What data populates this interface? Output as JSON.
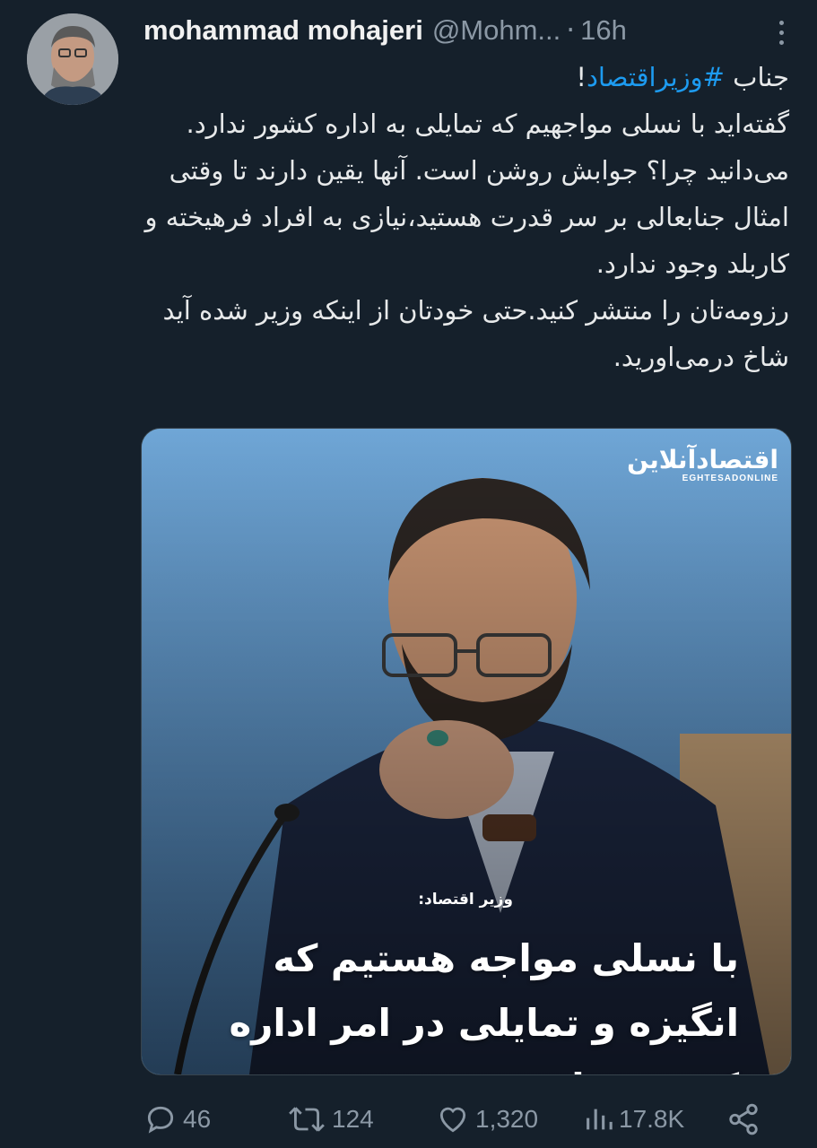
{
  "author": {
    "name": "mohammad mohajeri",
    "handle": "@Mohm...",
    "separator": "·",
    "time": "16h"
  },
  "tweet": {
    "prefix": "جناب ",
    "hashtag": "#وزیراقتصاد",
    "suffix": "!",
    "paragraphs": [
      "گفته‌اید با نسلی مواجهیم که تمایلی به  اداره کشور ندارد.",
      "می‌دانید چرا؟ جوابش روشن است. آنها یقین دارند تا وقتی امثال جنابعالی بر سر قدرت هستید،نیازی به افراد فرهیخته و کاربلد وجود ندارد.",
      "رزومه‌تان را منتشر کنید.حتی خودتان از اینکه وزیر شده آید شاخ درمی‌اورید."
    ]
  },
  "media": {
    "logo_fa": "اقتصادآنلاین",
    "logo_en": "EGHTESADONLINE",
    "caption_small": "وزیر اقتصاد:",
    "caption_big": "با نسلی مواجه هستیم که انگیزه و تمایلی در امر اداره کشور ندارند"
  },
  "actions": {
    "replies": "46",
    "retweets": "124",
    "likes": "1,320",
    "views": "17.8K"
  },
  "icons": [
    "reply-icon",
    "retweet-icon",
    "like-icon",
    "views-icon",
    "share-icon",
    "more-icon"
  ],
  "colors": {
    "background": "#15202b",
    "hashtag": "#1d9bf0",
    "muted": "#8b98a5"
  }
}
